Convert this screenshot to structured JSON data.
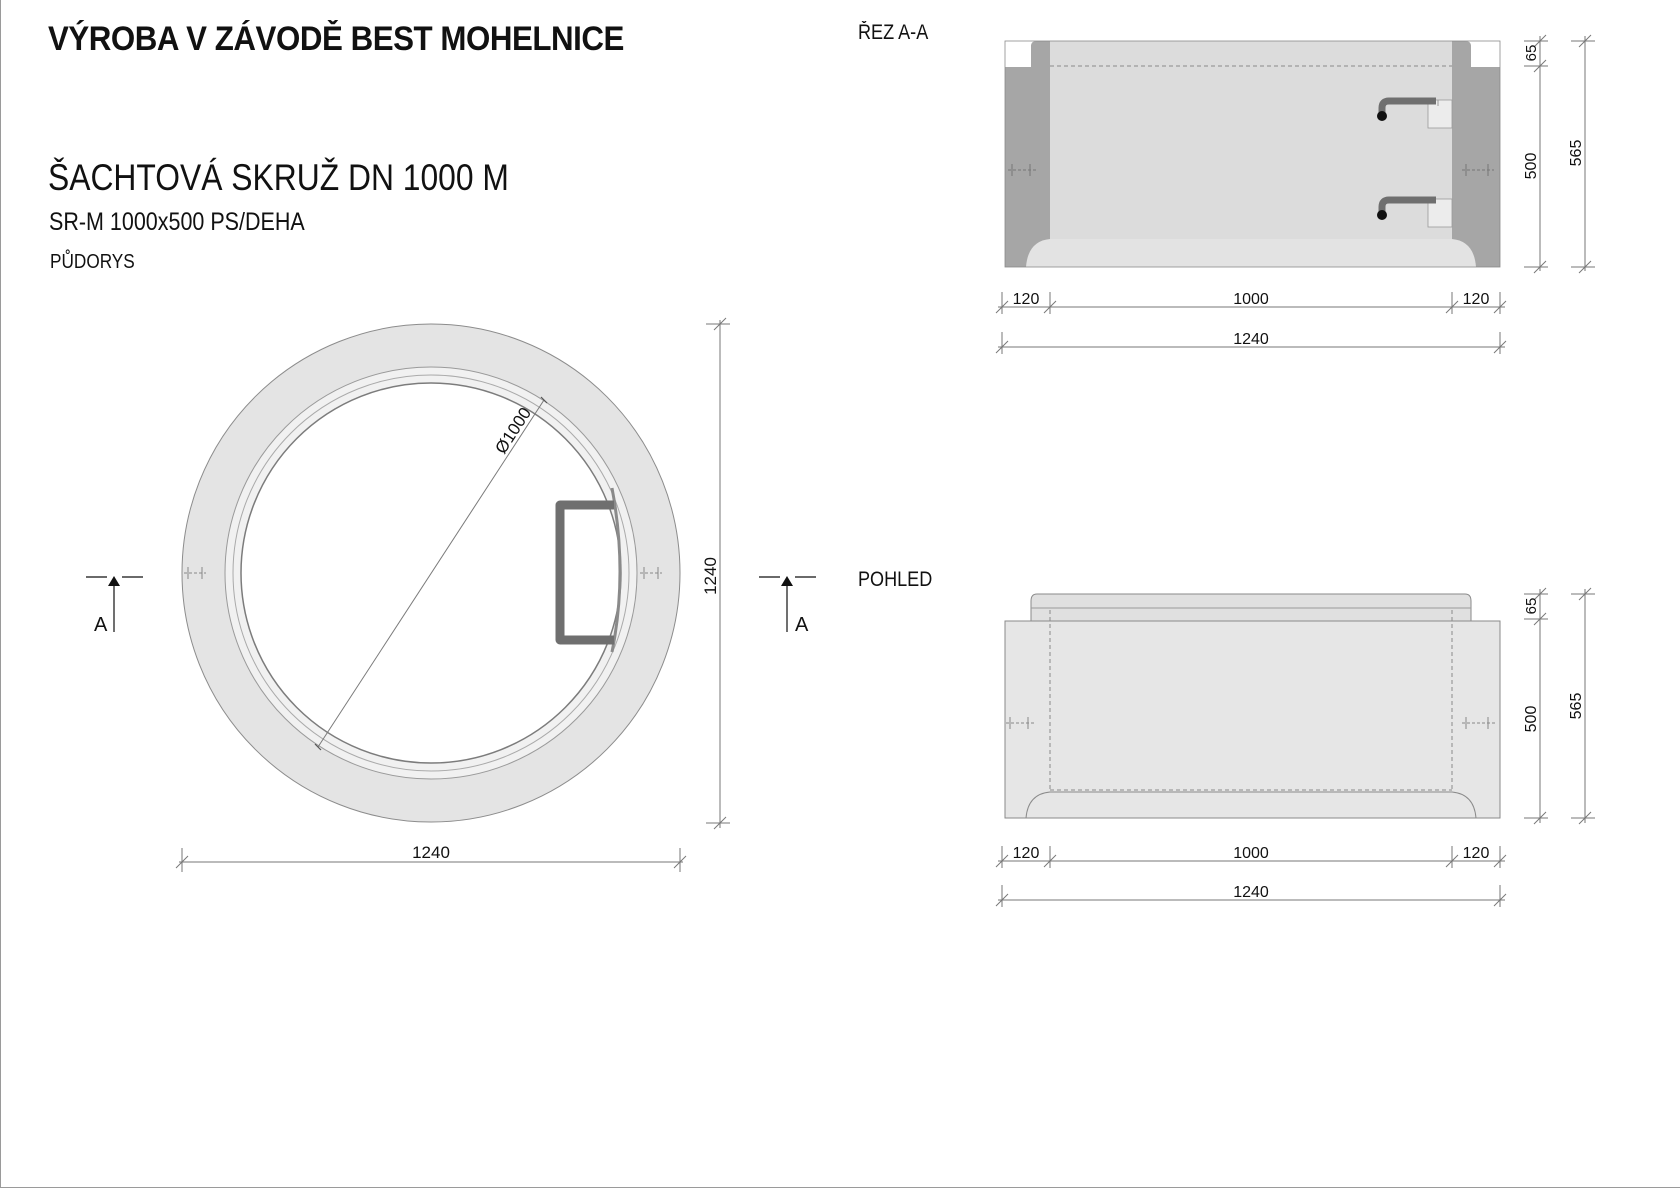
{
  "header": {
    "company_title": "VÝROBA V ZÁVODĚ BEST MOHELNICE",
    "product_title": "ŠACHTOVÁ SKRUŽ DN 1000 M",
    "product_code": "SR-M 1000x500 PS/DEHA"
  },
  "views": {
    "plan_label": "PŮDORYS",
    "section_label": "ŘEZ A-A",
    "elevation_label": "POHLED"
  },
  "plan": {
    "diameter_label": "Ø1000",
    "width_dim": "1240",
    "height_dim": "1240",
    "section_mark_left": "A",
    "section_mark_right": "A"
  },
  "section": {
    "dim_wall_left": "120",
    "dim_inner": "1000",
    "dim_wall_right": "120",
    "dim_overall": "1240",
    "dim_rebate": "65",
    "dim_body": "500",
    "dim_total_height": "565"
  },
  "elevation": {
    "dim_wall_left": "120",
    "dim_inner": "1000",
    "dim_wall_right": "120",
    "dim_overall": "1240",
    "dim_rebate": "65",
    "dim_body": "500",
    "dim_total_height": "565"
  },
  "colors": {
    "concrete_light": "#e6e6e6",
    "concrete_mid": "#d4d4d4",
    "concrete_section": "#a6a6a6",
    "steel_step": "#6f6f6f",
    "dimension_line": "#777777"
  }
}
